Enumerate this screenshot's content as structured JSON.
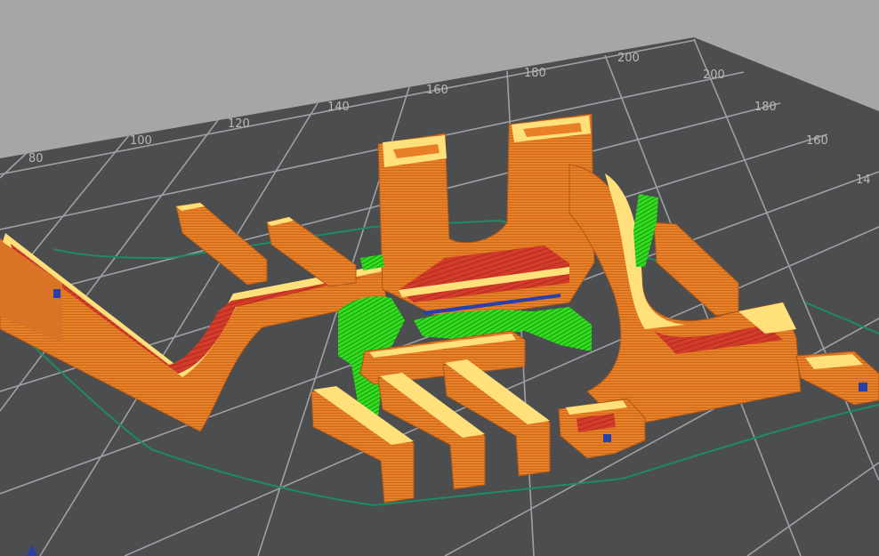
{
  "viewer": {
    "background_color": "#a6a6a6",
    "bed_color": "#4c4d4f",
    "grid_color": "#9ea0a3",
    "skirt_color": "#1f8a63",
    "colors": {
      "perimeter": "#e98027",
      "inner_perimeter": "#ffe07a",
      "top_solid": "#d33b2a",
      "support": "#33e020",
      "bridge": "#2a3fa8"
    },
    "top_axis_ticks": [
      "80",
      "100",
      "120",
      "140",
      "160",
      "180",
      "200"
    ],
    "right_axis_ticks": [
      "200",
      "180",
      "160",
      "14"
    ]
  }
}
